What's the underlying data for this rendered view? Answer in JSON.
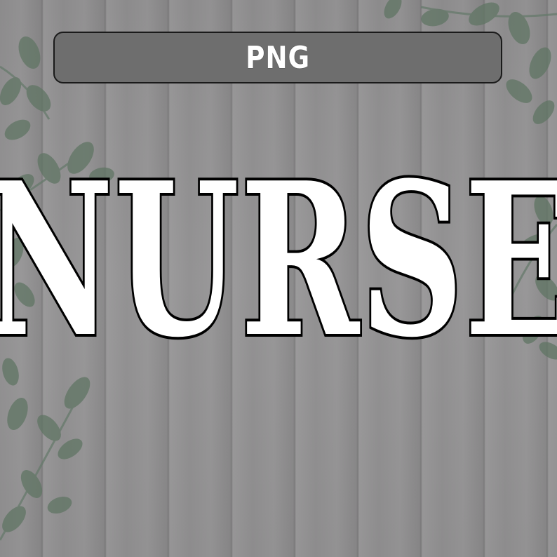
{
  "badge": {
    "label": "PNG"
  },
  "headline": {
    "text": "NURSE"
  },
  "colors": {
    "background": "#8f8e8f",
    "badge_fill": "#6e6e6e",
    "text_fill": "#ffffff",
    "text_outline": "#000000",
    "leaves": "#5f7563"
  },
  "decor": {
    "background_icon": "wood-plank-wall",
    "foliage_icon": "eucalyptus-leaves"
  }
}
